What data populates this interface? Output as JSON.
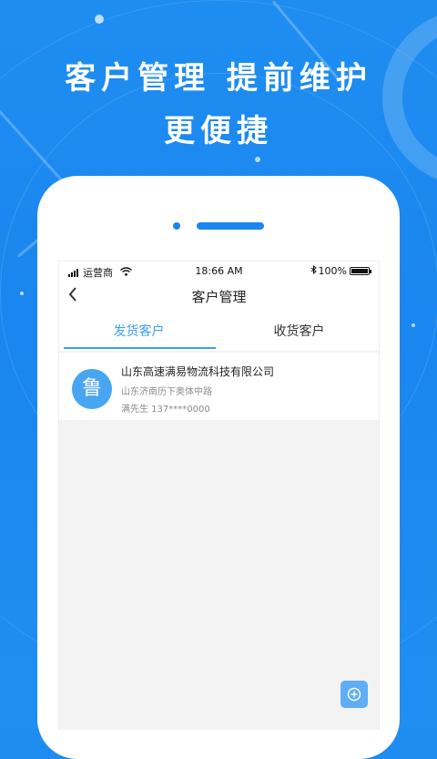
{
  "hero": {
    "line1": "客户管理 提前维护",
    "line2": "更便捷"
  },
  "status_bar": {
    "carrier": "运营商",
    "time": "18:66 AM",
    "battery_text": "100%",
    "wifi_icon": "wifi-icon",
    "bluetooth_icon": "bluetooth-icon"
  },
  "nav": {
    "back_icon": "chevron-left-icon",
    "title": "客户管理"
  },
  "tabs": [
    {
      "label": "发货客户",
      "active": true
    },
    {
      "label": "收货客户",
      "active": false
    }
  ],
  "customers": [
    {
      "avatar_char": "鲁",
      "name": "山东高速满易物流科技有限公司",
      "address": "山东济南历下奥体中路",
      "contact": "满先生 137****0000"
    }
  ],
  "add_button": {
    "icon": "plus-circle-icon"
  },
  "colors": {
    "background": "#1a86ef",
    "accent": "#3d9ef5",
    "avatar": "#48a5f2"
  }
}
